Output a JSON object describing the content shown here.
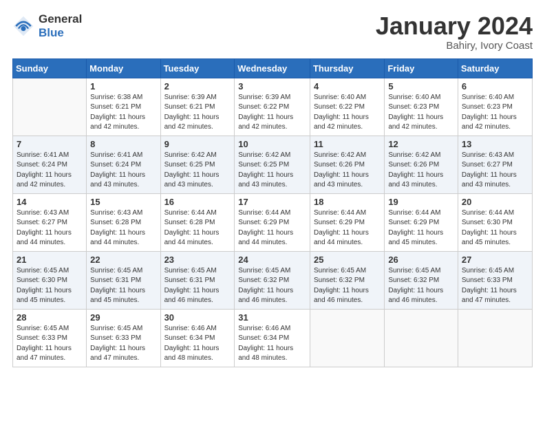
{
  "header": {
    "logo_general": "General",
    "logo_blue": "Blue",
    "title": "January 2024",
    "location": "Bahiry, Ivory Coast"
  },
  "days_of_week": [
    "Sunday",
    "Monday",
    "Tuesday",
    "Wednesday",
    "Thursday",
    "Friday",
    "Saturday"
  ],
  "weeks": [
    [
      {
        "day": "",
        "sunrise": "",
        "sunset": "",
        "daylight": "",
        "empty": true
      },
      {
        "day": "1",
        "sunrise": "Sunrise: 6:38 AM",
        "sunset": "Sunset: 6:21 PM",
        "daylight": "Daylight: 11 hours and 42 minutes."
      },
      {
        "day": "2",
        "sunrise": "Sunrise: 6:39 AM",
        "sunset": "Sunset: 6:21 PM",
        "daylight": "Daylight: 11 hours and 42 minutes."
      },
      {
        "day": "3",
        "sunrise": "Sunrise: 6:39 AM",
        "sunset": "Sunset: 6:22 PM",
        "daylight": "Daylight: 11 hours and 42 minutes."
      },
      {
        "day": "4",
        "sunrise": "Sunrise: 6:40 AM",
        "sunset": "Sunset: 6:22 PM",
        "daylight": "Daylight: 11 hours and 42 minutes."
      },
      {
        "day": "5",
        "sunrise": "Sunrise: 6:40 AM",
        "sunset": "Sunset: 6:23 PM",
        "daylight": "Daylight: 11 hours and 42 minutes."
      },
      {
        "day": "6",
        "sunrise": "Sunrise: 6:40 AM",
        "sunset": "Sunset: 6:23 PM",
        "daylight": "Daylight: 11 hours and 42 minutes."
      }
    ],
    [
      {
        "day": "7",
        "sunrise": "Sunrise: 6:41 AM",
        "sunset": "Sunset: 6:24 PM",
        "daylight": "Daylight: 11 hours and 42 minutes."
      },
      {
        "day": "8",
        "sunrise": "Sunrise: 6:41 AM",
        "sunset": "Sunset: 6:24 PM",
        "daylight": "Daylight: 11 hours and 43 minutes."
      },
      {
        "day": "9",
        "sunrise": "Sunrise: 6:42 AM",
        "sunset": "Sunset: 6:25 PM",
        "daylight": "Daylight: 11 hours and 43 minutes."
      },
      {
        "day": "10",
        "sunrise": "Sunrise: 6:42 AM",
        "sunset": "Sunset: 6:25 PM",
        "daylight": "Daylight: 11 hours and 43 minutes."
      },
      {
        "day": "11",
        "sunrise": "Sunrise: 6:42 AM",
        "sunset": "Sunset: 6:26 PM",
        "daylight": "Daylight: 11 hours and 43 minutes."
      },
      {
        "day": "12",
        "sunrise": "Sunrise: 6:42 AM",
        "sunset": "Sunset: 6:26 PM",
        "daylight": "Daylight: 11 hours and 43 minutes."
      },
      {
        "day": "13",
        "sunrise": "Sunrise: 6:43 AM",
        "sunset": "Sunset: 6:27 PM",
        "daylight": "Daylight: 11 hours and 43 minutes."
      }
    ],
    [
      {
        "day": "14",
        "sunrise": "Sunrise: 6:43 AM",
        "sunset": "Sunset: 6:27 PM",
        "daylight": "Daylight: 11 hours and 44 minutes."
      },
      {
        "day": "15",
        "sunrise": "Sunrise: 6:43 AM",
        "sunset": "Sunset: 6:28 PM",
        "daylight": "Daylight: 11 hours and 44 minutes."
      },
      {
        "day": "16",
        "sunrise": "Sunrise: 6:44 AM",
        "sunset": "Sunset: 6:28 PM",
        "daylight": "Daylight: 11 hours and 44 minutes."
      },
      {
        "day": "17",
        "sunrise": "Sunrise: 6:44 AM",
        "sunset": "Sunset: 6:29 PM",
        "daylight": "Daylight: 11 hours and 44 minutes."
      },
      {
        "day": "18",
        "sunrise": "Sunrise: 6:44 AM",
        "sunset": "Sunset: 6:29 PM",
        "daylight": "Daylight: 11 hours and 44 minutes."
      },
      {
        "day": "19",
        "sunrise": "Sunrise: 6:44 AM",
        "sunset": "Sunset: 6:29 PM",
        "daylight": "Daylight: 11 hours and 45 minutes."
      },
      {
        "day": "20",
        "sunrise": "Sunrise: 6:44 AM",
        "sunset": "Sunset: 6:30 PM",
        "daylight": "Daylight: 11 hours and 45 minutes."
      }
    ],
    [
      {
        "day": "21",
        "sunrise": "Sunrise: 6:45 AM",
        "sunset": "Sunset: 6:30 PM",
        "daylight": "Daylight: 11 hours and 45 minutes."
      },
      {
        "day": "22",
        "sunrise": "Sunrise: 6:45 AM",
        "sunset": "Sunset: 6:31 PM",
        "daylight": "Daylight: 11 hours and 45 minutes."
      },
      {
        "day": "23",
        "sunrise": "Sunrise: 6:45 AM",
        "sunset": "Sunset: 6:31 PM",
        "daylight": "Daylight: 11 hours and 46 minutes."
      },
      {
        "day": "24",
        "sunrise": "Sunrise: 6:45 AM",
        "sunset": "Sunset: 6:32 PM",
        "daylight": "Daylight: 11 hours and 46 minutes."
      },
      {
        "day": "25",
        "sunrise": "Sunrise: 6:45 AM",
        "sunset": "Sunset: 6:32 PM",
        "daylight": "Daylight: 11 hours and 46 minutes."
      },
      {
        "day": "26",
        "sunrise": "Sunrise: 6:45 AM",
        "sunset": "Sunset: 6:32 PM",
        "daylight": "Daylight: 11 hours and 46 minutes."
      },
      {
        "day": "27",
        "sunrise": "Sunrise: 6:45 AM",
        "sunset": "Sunset: 6:33 PM",
        "daylight": "Daylight: 11 hours and 47 minutes."
      }
    ],
    [
      {
        "day": "28",
        "sunrise": "Sunrise: 6:45 AM",
        "sunset": "Sunset: 6:33 PM",
        "daylight": "Daylight: 11 hours and 47 minutes."
      },
      {
        "day": "29",
        "sunrise": "Sunrise: 6:45 AM",
        "sunset": "Sunset: 6:33 PM",
        "daylight": "Daylight: 11 hours and 47 minutes."
      },
      {
        "day": "30",
        "sunrise": "Sunrise: 6:46 AM",
        "sunset": "Sunset: 6:34 PM",
        "daylight": "Daylight: 11 hours and 48 minutes."
      },
      {
        "day": "31",
        "sunrise": "Sunrise: 6:46 AM",
        "sunset": "Sunset: 6:34 PM",
        "daylight": "Daylight: 11 hours and 48 minutes."
      },
      {
        "day": "",
        "sunrise": "",
        "sunset": "",
        "daylight": "",
        "empty": true
      },
      {
        "day": "",
        "sunrise": "",
        "sunset": "",
        "daylight": "",
        "empty": true
      },
      {
        "day": "",
        "sunrise": "",
        "sunset": "",
        "daylight": "",
        "empty": true
      }
    ]
  ]
}
